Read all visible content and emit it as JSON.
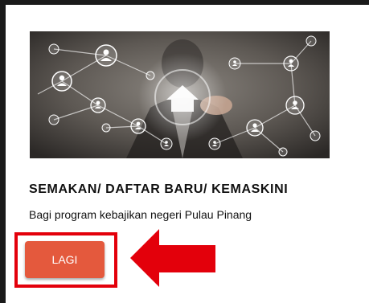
{
  "card": {
    "image": {
      "icon": "network-people-house-icon",
      "alt": ""
    },
    "title": "SEMAKAN/ DAFTAR BARU/ KEMASKINI",
    "description": "Bagi program kebajikan negeri Pulau Pinang",
    "button_label": "LAGI"
  },
  "annotation": {
    "highlight_color": "#e3000b",
    "arrow_icon": "left-arrow-icon",
    "arrow_color": "#e3000b"
  },
  "colors": {
    "button": "#e4593d",
    "button_text": "#ffffff",
    "text": "#111111"
  }
}
